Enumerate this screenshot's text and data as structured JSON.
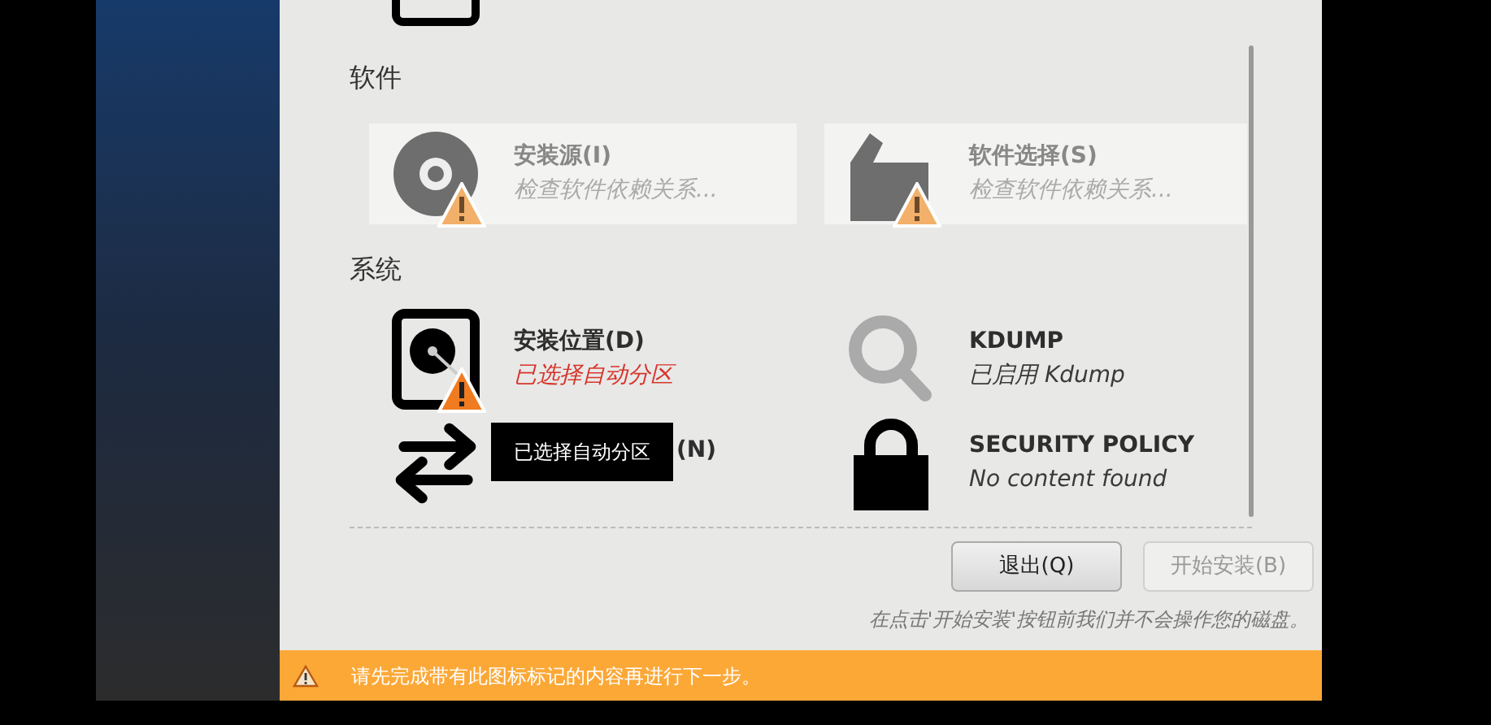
{
  "sections": [
    {
      "title": "软件",
      "items": [
        {
          "kind": "disc",
          "title": "安装源(I)",
          "status": "检查软件依赖关系...",
          "disabled": true,
          "warning": true,
          "status_error": false,
          "under_tooltip": false
        },
        {
          "kind": "package",
          "title": "软件选择(S)",
          "status": "检查软件依赖关系...",
          "disabled": true,
          "warning": true,
          "status_error": false,
          "under_tooltip": false
        }
      ]
    },
    {
      "title": "系统",
      "items": [
        {
          "kind": "disk",
          "title": "安装位置(D)",
          "status": "已选择自动分区",
          "disabled": false,
          "warning": true,
          "status_error": true,
          "under_tooltip": false
        },
        {
          "kind": "search",
          "title": "KDUMP",
          "status": "已启用 Kdump",
          "disabled": false,
          "warning": false,
          "status_error": false,
          "under_tooltip": false
        },
        {
          "kind": "network",
          "title": "(N)",
          "disabled": false,
          "warning": false,
          "under_tooltip": true
        },
        {
          "kind": "lock",
          "title": "SECURITY POLICY",
          "status": "No content found",
          "disabled": false,
          "warning": false,
          "status_error": false,
          "under_tooltip": false
        }
      ]
    }
  ],
  "tooltip": "已选择自动分区",
  "buttons": [
    {
      "label": "退出(Q)",
      "disabled": false
    },
    {
      "label": "开始安装(B)",
      "disabled": true
    }
  ],
  "note": "在点击'开始安装'按钮前我们并不会操作您的磁盘。",
  "warning_bar": "请先完成带有此图标标记的内容再进行下一步。"
}
